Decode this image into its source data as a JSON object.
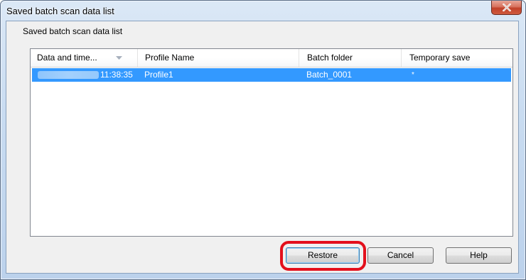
{
  "window": {
    "title": "Saved batch scan data list"
  },
  "dialog": {
    "group_label": "Saved batch scan data list",
    "columns": [
      "Data and time...",
      "Profile Name",
      "Batch folder",
      "Temporary save"
    ],
    "rows": [
      {
        "date_blurred": true,
        "time": "11:38:35",
        "profile": "Profile1",
        "batch_folder": "Batch_0001",
        "temporary_save": "*",
        "selected": true
      }
    ]
  },
  "buttons": {
    "restore": "Restore",
    "cancel": "Cancel",
    "help": "Help"
  },
  "colors": {
    "selection": "#3399ff",
    "highlight_ring": "#e3101c",
    "close_button": "#c94a31"
  },
  "icons": {
    "close": "close-icon",
    "sort": "sort-descending-icon"
  }
}
